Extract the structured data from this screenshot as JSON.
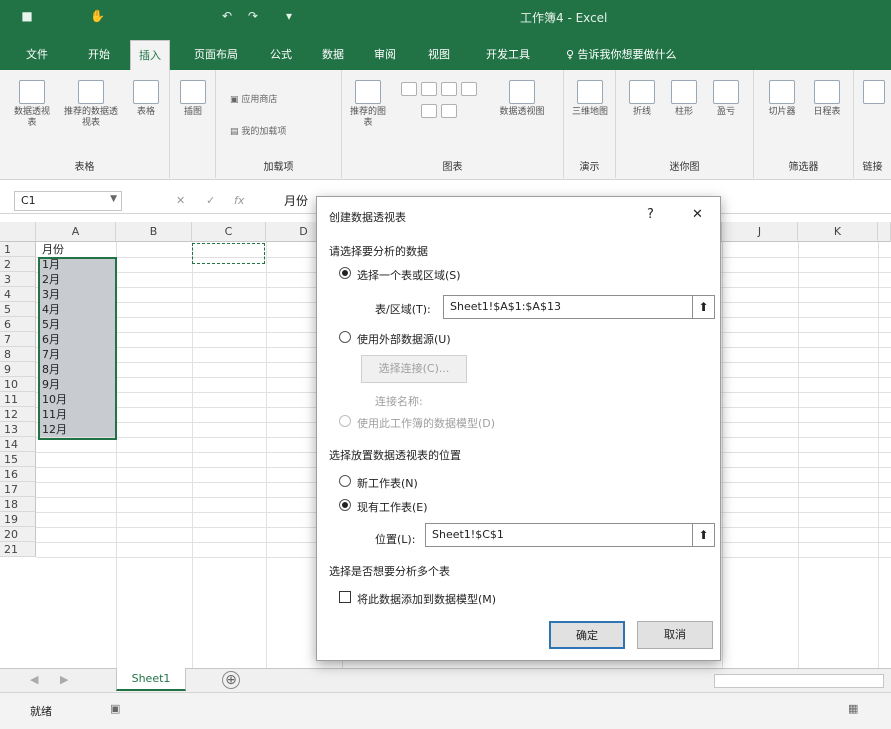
{
  "window": {
    "title": "工作簿4 - Excel"
  },
  "quick_access": {
    "icons": [
      "save-icon",
      "undo-icon",
      "redo-icon",
      "touch-mode-icon",
      "customize-icon"
    ]
  },
  "tabs": [
    {
      "label": "文件"
    },
    {
      "label": "开始"
    },
    {
      "label": "插入"
    },
    {
      "label": "页面布局"
    },
    {
      "label": "公式"
    },
    {
      "label": "数据"
    },
    {
      "label": "审阅"
    },
    {
      "label": "视图"
    },
    {
      "label": "开发工具"
    }
  ],
  "tell_me": "♀ 告诉我你想要做什么",
  "ribbon": {
    "tables": {
      "label": "表格",
      "pivot": "数据透视表",
      "recommended": "推荐的数据透视表",
      "table": "表格"
    },
    "illustrations": {
      "label": "插图"
    },
    "addins": {
      "label": "加载项",
      "store": "应用商店",
      "my_addins": "我的加载项"
    },
    "charts": {
      "label": "图表",
      "recommended": "推荐的图表",
      "pivotchart": "数据透视图"
    },
    "tours": {
      "label": "演示",
      "map3d": "三维地图"
    },
    "sparklines": {
      "label": "迷你图",
      "line": "折线",
      "column": "柱形",
      "winloss": "盈亏"
    },
    "filters": {
      "label": "筛选器",
      "slicer": "切片器",
      "timeline": "日程表"
    },
    "links": {
      "label": "链接"
    }
  },
  "formula_bar": {
    "name_box": "C1",
    "value": "月份"
  },
  "grid": {
    "columns": [
      "A",
      "B",
      "C",
      "D",
      "J",
      "K"
    ],
    "rows": [
      "1",
      "2",
      "3",
      "4",
      "5",
      "6",
      "7",
      "8",
      "9",
      "10",
      "11",
      "12",
      "13",
      "14",
      "15",
      "16",
      "17",
      "18",
      "19",
      "20",
      "21"
    ],
    "col_a": [
      "月份",
      "1月",
      "2月",
      "3月",
      "4月",
      "5月",
      "6月",
      "7月",
      "8月",
      "9月",
      "10月",
      "11月",
      "12月"
    ]
  },
  "sheet": {
    "tab": "Sheet1",
    "add": "⊕"
  },
  "status": {
    "mode": "就绪"
  },
  "dialog": {
    "title": "创建数据透视表",
    "help": "?",
    "close": "✕",
    "section1": "请选择要分析的数据",
    "opt_range": "选择一个表或区域(S)",
    "range_label": "表/区域(T):",
    "range_value": "Sheet1!$A$1:$A$13",
    "opt_external": "使用外部数据源(U)",
    "choose_conn": "选择连接(C)...",
    "conn_name": "连接名称:",
    "opt_datamodel": "使用此工作簿的数据模型(D)",
    "section2": "选择放置数据透视表的位置",
    "opt_new": "新工作表(N)",
    "opt_existing": "现有工作表(E)",
    "location_label": "位置(L):",
    "location_value": "Sheet1!$C$1",
    "section3": "选择是否想要分析多个表",
    "add_model": "将此数据添加到数据模型(M)",
    "ok": "确定",
    "cancel": "取消"
  }
}
